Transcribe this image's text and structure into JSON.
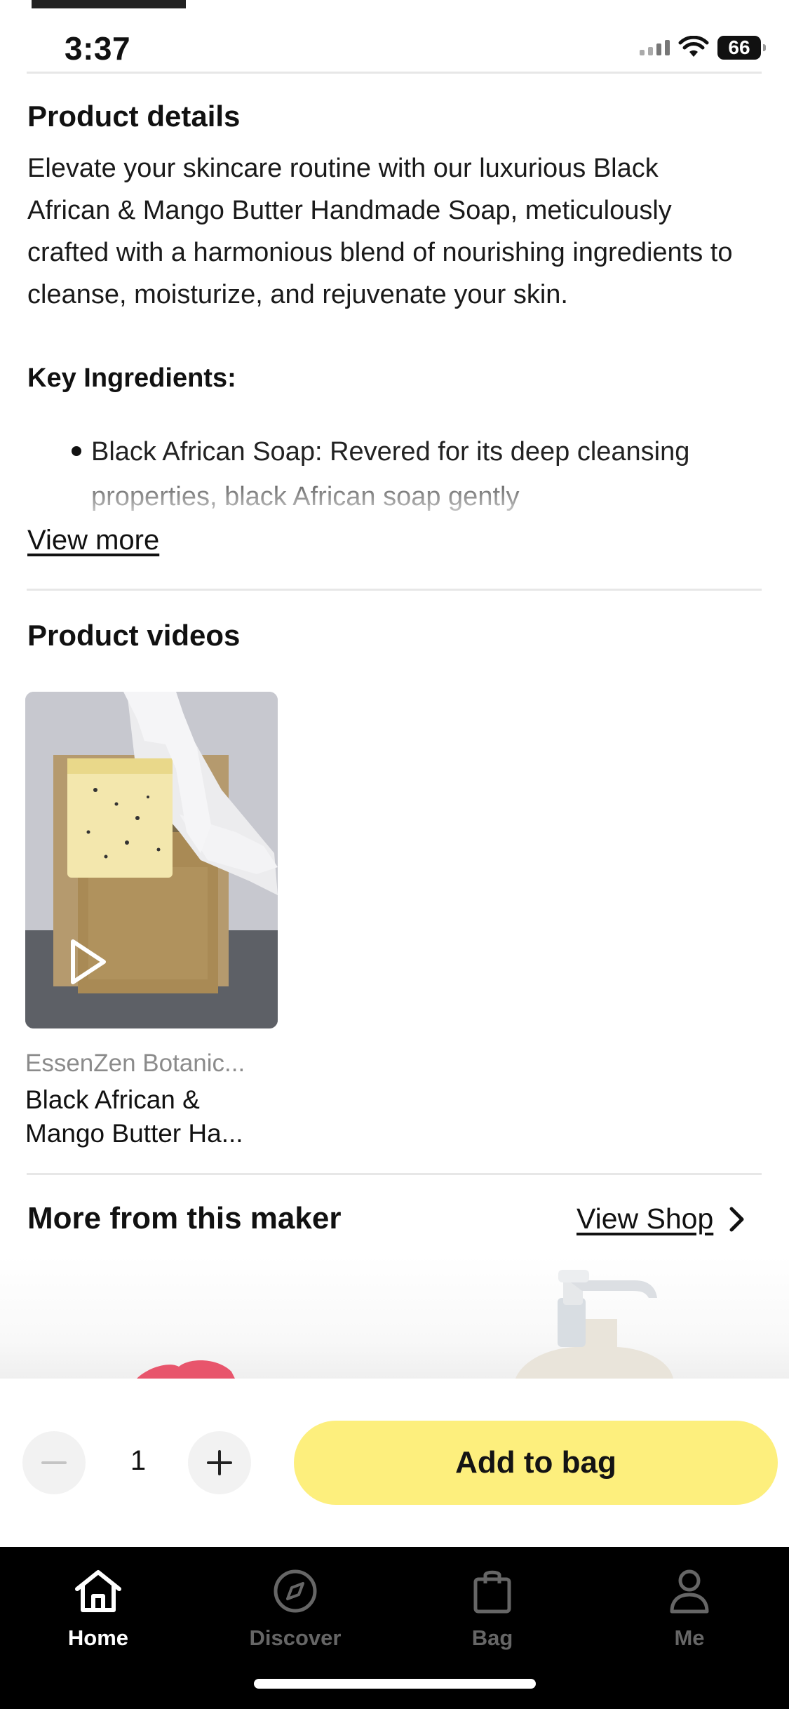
{
  "status_bar": {
    "time": "3:37",
    "battery": "66"
  },
  "product_details": {
    "title": "Product details",
    "description": "Elevate your skincare routine with our luxurious Black African & Mango Butter Handmade Soap, meticulously crafted with a harmonious blend of nourishing ingredients to cleanse, moisturize, and rejuvenate your skin.",
    "key_ingredients_label": "Key Ingredients:",
    "bullet_text": "Black African Soap: Revered for its deep cleansing properties, black African soap gently",
    "view_more": "View more"
  },
  "product_videos": {
    "title": "Product videos",
    "video": {
      "shop": "EssenZen Botanic...",
      "title": "Black African & Mango Butter Ha..."
    }
  },
  "more_from_maker": {
    "title": "More from this maker",
    "view_shop": "View Shop"
  },
  "purchase": {
    "quantity": "1",
    "add_to_bag": "Add to bag"
  },
  "tabbar": {
    "tabs": [
      {
        "label": "Home",
        "icon": "home-icon",
        "active": true
      },
      {
        "label": "Discover",
        "icon": "compass-icon",
        "active": false
      },
      {
        "label": "Bag",
        "icon": "bag-icon",
        "active": false
      },
      {
        "label": "Me",
        "icon": "person-icon",
        "active": false
      }
    ]
  },
  "colors": {
    "accent": "#fdef7d",
    "tabbar_bg": "#000000",
    "muted_text": "#8b8b8b"
  }
}
